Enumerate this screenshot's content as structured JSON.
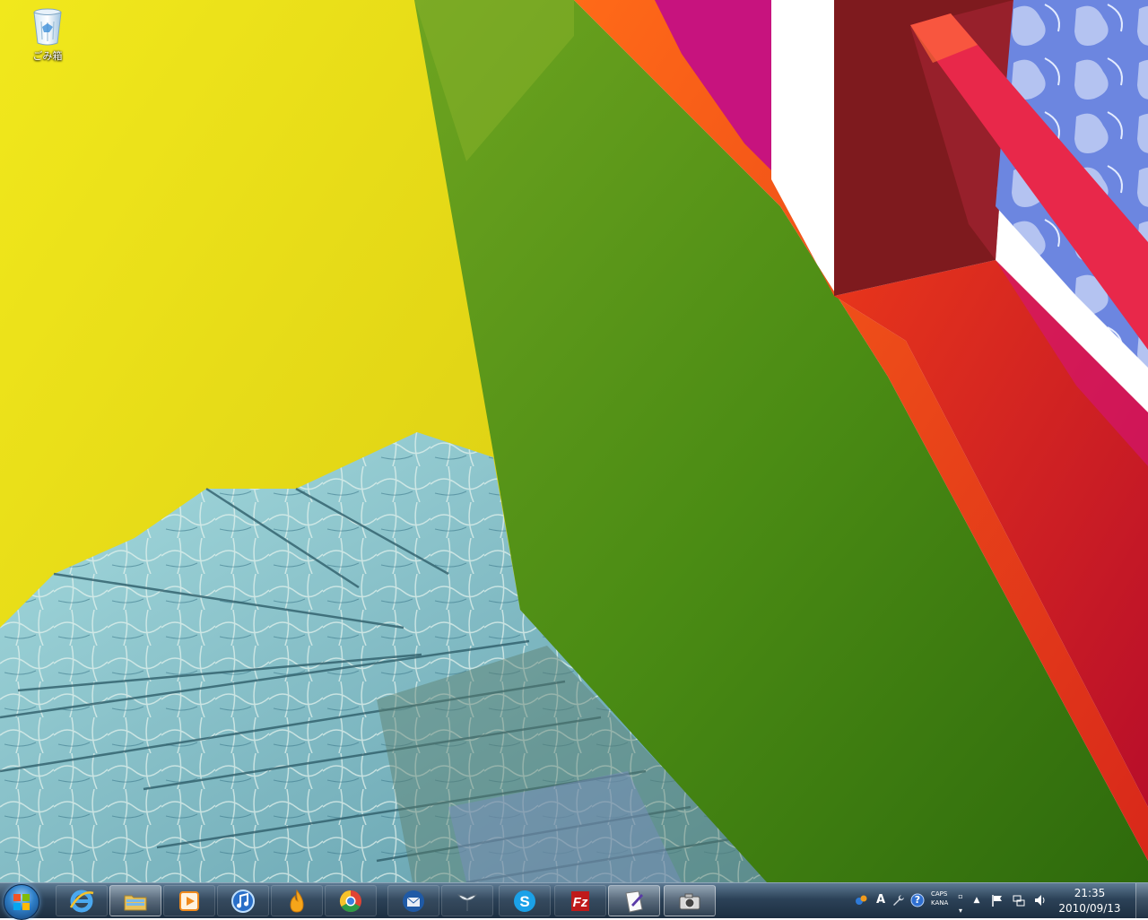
{
  "desktop": {
    "icons": [
      {
        "label": "ごみ箱",
        "icon": "recycle-bin-icon"
      }
    ]
  },
  "taskbar": {
    "pinned": [
      {
        "name": "internet-explorer",
        "icon": "internet-explorer-icon",
        "running": false
      },
      {
        "name": "windows-explorer",
        "icon": "folder-icon",
        "running": true
      },
      {
        "name": "media-player",
        "icon": "media-player-icon",
        "running": false
      },
      {
        "name": "itunes",
        "icon": "music-note-icon",
        "running": false
      },
      {
        "name": "launcher",
        "icon": "flame-icon",
        "running": false
      },
      {
        "name": "google-chrome",
        "icon": "chrome-icon",
        "running": false
      },
      {
        "name": "thunderbird",
        "icon": "mail-bird-icon",
        "running": false
      },
      {
        "name": "orca-app",
        "icon": "whale-tail-icon",
        "running": false
      },
      {
        "name": "skype",
        "icon": "skype-icon",
        "running": false
      },
      {
        "name": "filezilla",
        "icon": "filezilla-icon",
        "running": false
      },
      {
        "name": "editor",
        "icon": "pen-paper-icon",
        "running": true
      },
      {
        "name": "camera-app",
        "icon": "camera-icon",
        "running": true
      }
    ]
  },
  "tray": {
    "caps": "CAPS",
    "kana": "KANA",
    "time": "21:35",
    "date": "2010/09/13",
    "ime_char": "A",
    "help_char": "?"
  },
  "colors": {
    "wall_yellow": "#ece11a",
    "wall_green": "#4e8f16",
    "rail_red": "#e0291c",
    "rail_magenta": "#d4127a",
    "stair_blue": "#8cc6d4",
    "taskbar": "#2c4258"
  }
}
